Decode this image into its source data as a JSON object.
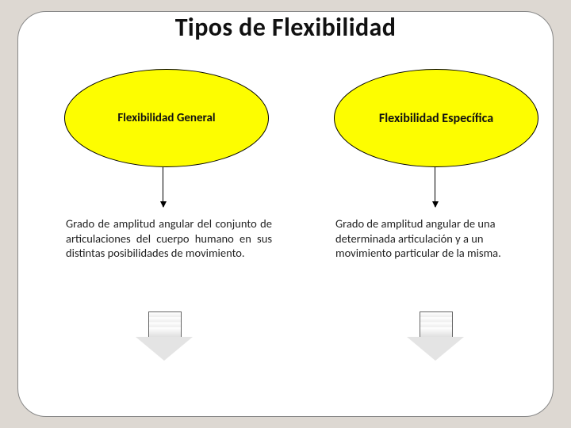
{
  "title": "Tipos de Flexibilidad",
  "left": {
    "heading": "Flexibilidad General",
    "description": "Grado de amplitud angular del conjunto de articulaciones del cuerpo humano en sus distintas posibilidades de movimiento."
  },
  "right": {
    "heading": "Flexibilidad Específica",
    "description": "Grado de amplitud angular de una determinada articulación y a un movimiento particular de la misma."
  }
}
